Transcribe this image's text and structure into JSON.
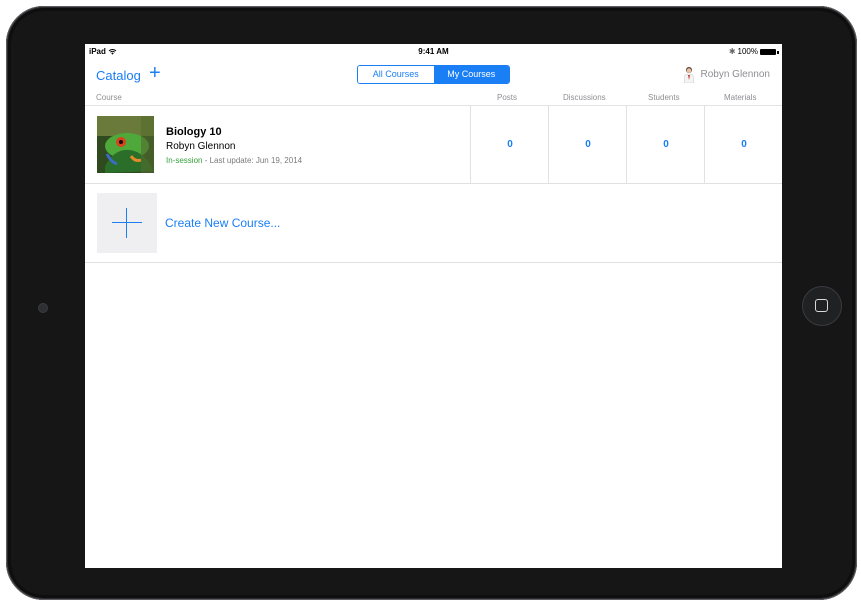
{
  "status_bar": {
    "carrier": "iPad",
    "time": "9:41 AM",
    "battery": "100%"
  },
  "nav": {
    "catalog_label": "Catalog",
    "add_symbol": "+",
    "segments": [
      {
        "label": "All Courses",
        "selected": false
      },
      {
        "label": "My Courses",
        "selected": true
      }
    ],
    "user_name": "Robyn Glennon"
  },
  "table": {
    "headers": {
      "course": "Course",
      "posts": "Posts",
      "discussions": "Discussions",
      "students": "Students",
      "materials": "Materials"
    },
    "courses": [
      {
        "title": "Biology 10",
        "teacher": "Robyn Glennon",
        "status": "In-session",
        "last_update": " - Last update: Jun 19, 2014",
        "posts": "0",
        "discussions": "0",
        "students": "0",
        "materials": "0"
      }
    ],
    "create_label": "Create New Course..."
  },
  "colors": {
    "accent": "#1a7ef5",
    "status_green": "#36a03b",
    "muted_text": "#8e8e93"
  }
}
